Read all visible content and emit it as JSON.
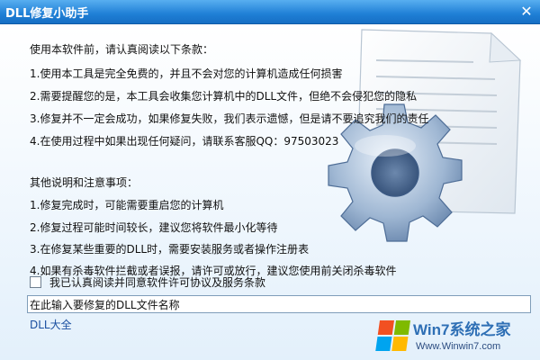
{
  "window": {
    "title": "DLL修复小助手",
    "close_glyph": "✕"
  },
  "terms": {
    "heading": "使用本软件前，请认真阅读以下条款：",
    "items": [
      "1.使用本工具是完全免费的，并且不会对您的计算机造成任何损害",
      "2.需要提醒您的是，本工具会收集您计算机中的DLL文件，但绝不会侵犯您的隐私",
      "3.修复并不一定会成功，如果修复失败，我们表示遗憾，但是请不要追究我们的责任",
      "4.在使用过程中如果出现任何疑问，请联系客服QQ：97503023"
    ]
  },
  "notes": {
    "heading": "其他说明和注意事项：",
    "items": [
      "1.修复完成时，可能需要重启您的计算机",
      "2.修复过程可能时间较长，建议您将软件最小化等待",
      "3.在修复某些重要的DLL时，需要安装服务或者操作注册表",
      "4.如果有杀毒软件拦截或者误报，请许可或放行，建议您使用前关闭杀毒软件"
    ]
  },
  "agreement": {
    "label": "我已认真阅读并同意软件许可协议及服务条款",
    "checked": false
  },
  "dll_input": {
    "value": "在此输入要修复的DLL文件名称"
  },
  "footer_link": "DLL大全",
  "watermark": {
    "brand": "Win7系统之家",
    "url": "Www.Winwin7.com"
  },
  "icons": {
    "document": "document-icon",
    "gear": "gear-icon",
    "windows_logo": "windows-logo-icon"
  },
  "colors": {
    "titlebar": "#1f7fd6",
    "link": "#1a4fa0",
    "watermark_blue": "#2e6fb5"
  }
}
